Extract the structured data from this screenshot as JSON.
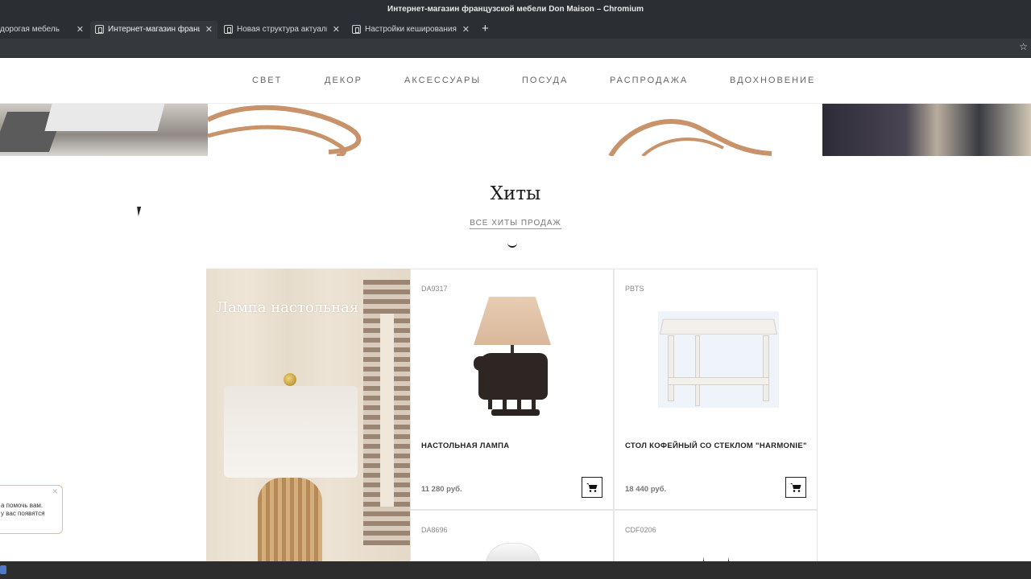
{
  "window": {
    "title": "Интернет-магазин французской мебели Don Maison – Chromium"
  },
  "tabs": [
    {
      "label": "дорогая мебель",
      "active": false
    },
    {
      "label": "Интернет-магазин франц",
      "active": true
    },
    {
      "label": "Новая структура актуаль",
      "active": false
    },
    {
      "label": "Настройки кеширования",
      "active": false
    }
  ],
  "nav": [
    "СВЕТ",
    "ДЕКОР",
    "АКСЕССУАРЫ",
    "ПОСУДА",
    "РАСПРОДАЖА",
    "ВДОХНОВЕНИЕ"
  ],
  "hits": {
    "title": "Хиты",
    "link": "ВСЕ ХИТЫ ПРОДАЖ",
    "hero_title": "Лампа настольная"
  },
  "products": [
    {
      "sku": "DA9317",
      "name": "НАСТОЛЬНАЯ ЛАМПА",
      "price": "11 280 руб."
    },
    {
      "sku": "PBTS",
      "name": "СТОЛ КОФЕЙНЫЙ СО СТЕКЛОМ \"HARMONIE\"",
      "price": "18 440 руб."
    },
    {
      "sku": "DA8696"
    },
    {
      "sku": "CDF0206"
    }
  ],
  "chat": {
    "line1": "а помочь вам.",
    "line2": "у вас появятся"
  },
  "colors": {
    "accent": "#c8936b",
    "dark": "#222222"
  }
}
